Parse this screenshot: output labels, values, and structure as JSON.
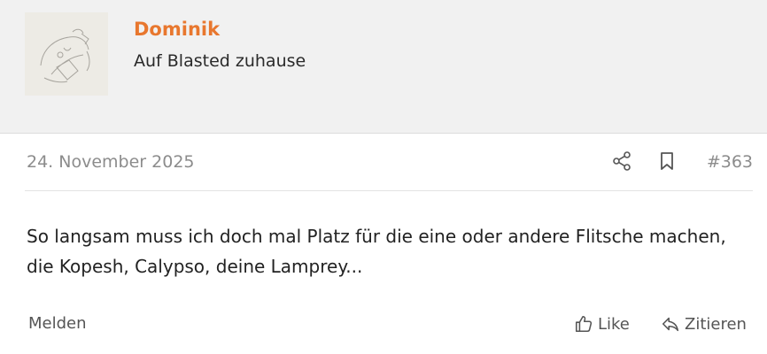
{
  "author": {
    "name": "Dominik",
    "title": "Auf Blasted zuhause",
    "avatar_icon": "sketch-drawing-avatar"
  },
  "meta": {
    "date": "24. November 2025",
    "post_number": "#363",
    "share_icon": "share-icon",
    "bookmark_icon": "bookmark-icon"
  },
  "body": {
    "text": "So langsam muss ich doch mal Platz für die eine oder andere Flitsche machen, die Kopesh, Calypso, deine Lamprey..."
  },
  "actions": {
    "report_label": "Melden",
    "like_label": "Like",
    "quote_label": "Zitieren"
  },
  "colors": {
    "username": "#e8772e",
    "header_bg": "#f1f1f1",
    "muted_text": "#8c8c8c"
  }
}
